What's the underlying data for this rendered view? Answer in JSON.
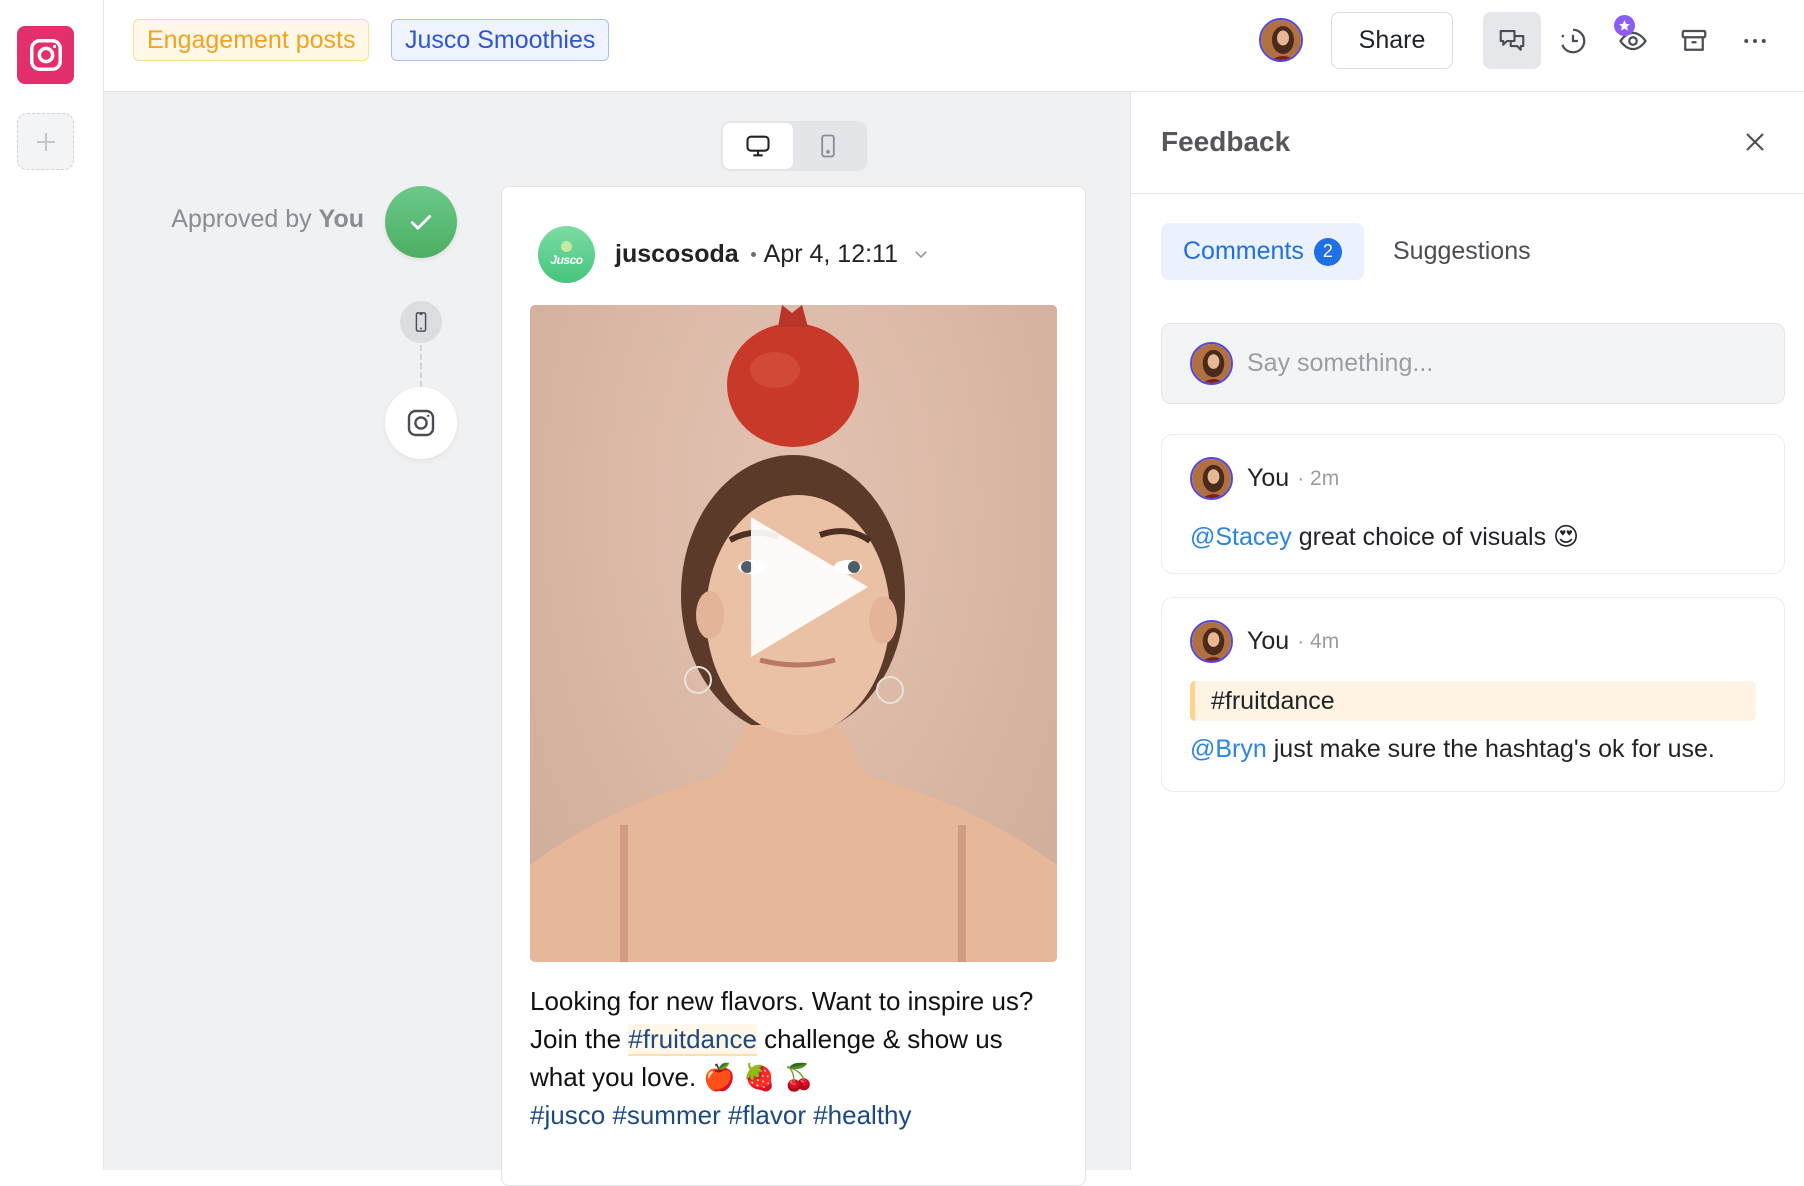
{
  "rail": {
    "channel_icon": "instagram-icon",
    "add_icon": "plus-icon"
  },
  "topbar": {
    "tags": [
      {
        "label": "Engagement posts",
        "color": "#f0a41c"
      },
      {
        "label": "Jusco Smoothies",
        "color": "#2f55d4"
      }
    ],
    "share_label": "Share",
    "icons": [
      "comments-icon",
      "history-icon",
      "preview-eye-icon",
      "archive-icon",
      "more-icon"
    ]
  },
  "canvas": {
    "view_toggle": {
      "options": [
        "desktop",
        "mobile"
      ],
      "selected": "desktop"
    },
    "approval": {
      "prefix": "Approved by",
      "by": "You",
      "status_color": "#4cae62"
    },
    "post": {
      "brand_initials": "Jusco",
      "handle": "juscosoda",
      "date": "Apr 4, 12:11",
      "media_type": "video",
      "caption_parts": {
        "line1": "Looking for new flavors. Want to inspire us? Join the ",
        "highlight": "#fruitdance",
        "line2": " challenge & show us what you love. 🍎 🍓 🍒",
        "hashtags": "#jusco #summer #flavor #healthy"
      }
    }
  },
  "feedback": {
    "title": "Feedback",
    "tabs": [
      {
        "label": "Comments",
        "count": "2",
        "active": true
      },
      {
        "label": "Suggestions",
        "active": false
      }
    ],
    "input_placeholder": "Say something...",
    "comments": [
      {
        "author": "You",
        "time": "· 2m",
        "mention": "@Stacey",
        "text": " great choice of visuals 😍"
      },
      {
        "author": "You",
        "time": "· 4m",
        "quote": "#fruitdance",
        "mention": "@Bryn",
        "text": " just make sure the hashtag's ok for use."
      }
    ]
  }
}
